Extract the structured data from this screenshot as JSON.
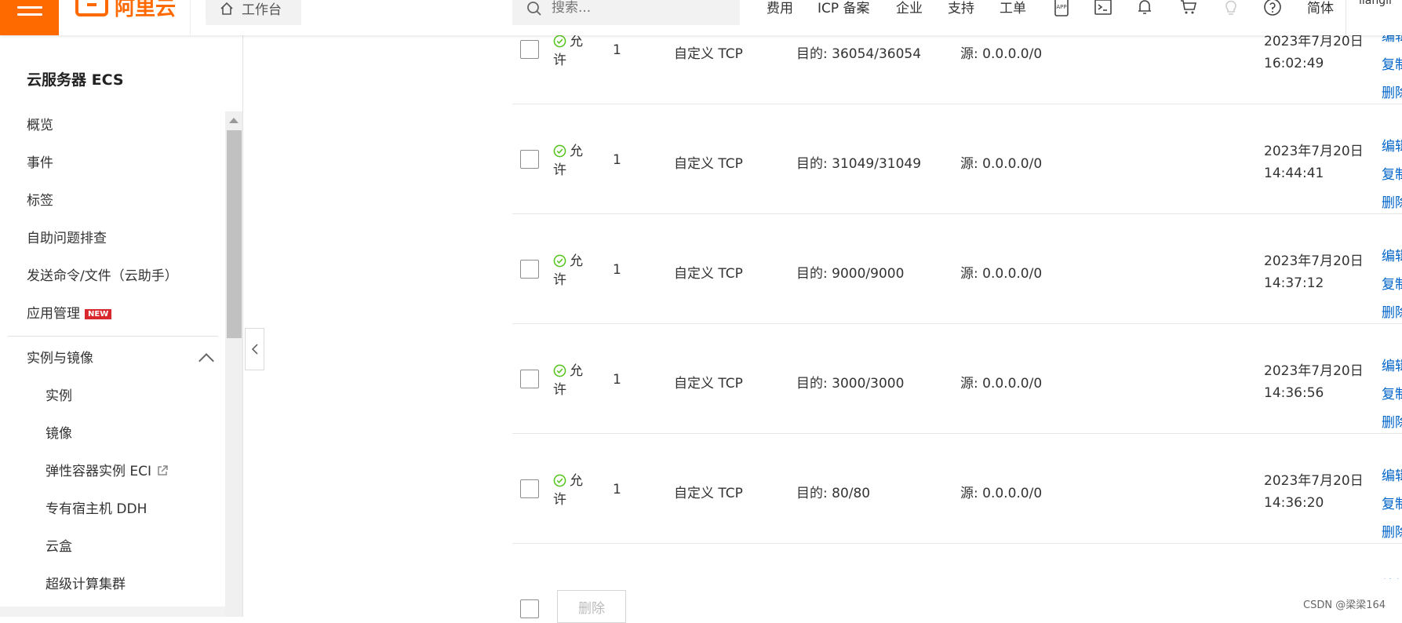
{
  "header": {
    "logo_text": "阿里云",
    "workbench_label": "工作台",
    "search_placeholder": "搜索...",
    "nav": [
      "费用",
      "ICP 备案",
      "企业",
      "支持",
      "工单"
    ],
    "icons": [
      "app-icon",
      "terminal-icon",
      "bell-icon",
      "cart-icon",
      "lightbulb-icon",
      "help-icon"
    ],
    "lang_label": "简体",
    "user_label": "liangli"
  },
  "sidebar": {
    "title": "云服务器 ECS",
    "items": [
      {
        "label": "概览"
      },
      {
        "label": "事件"
      },
      {
        "label": "标签"
      },
      {
        "label": "自助问题排查"
      },
      {
        "label": "发送命令/文件（云助手）"
      },
      {
        "label": "应用管理",
        "badge": "NEW"
      }
    ],
    "group": {
      "label": "实例与镜像",
      "children": [
        "实例",
        "镜像",
        "弹性容器实例 ECI",
        "专有宿主机 DDH",
        "云盒",
        "超级计算集群"
      ]
    }
  },
  "rules": {
    "rows": [
      {
        "action_1": "允",
        "action_2": "许",
        "priority": "1",
        "protocol": "自定义 TCP",
        "dest": "目的: 36054/36054",
        "source": "源: 0.0.0.0/0",
        "date": "2023年7月20日",
        "time": "16:02:49",
        "ops": [
          "编辑",
          "复制",
          "删除"
        ]
      },
      {
        "action_1": "允",
        "action_2": "许",
        "priority": "1",
        "protocol": "自定义 TCP",
        "dest": "目的: 31049/31049",
        "source": "源: 0.0.0.0/0",
        "date": "2023年7月20日",
        "time": "14:44:41",
        "ops": [
          "编辑",
          "复制",
          "删除"
        ]
      },
      {
        "action_1": "允",
        "action_2": "许",
        "priority": "1",
        "protocol": "自定义 TCP",
        "dest": "目的: 9000/9000",
        "source": "源: 0.0.0.0/0",
        "date": "2023年7月20日",
        "time": "14:37:12",
        "ops": [
          "编辑",
          "复制",
          "删除"
        ]
      },
      {
        "action_1": "允",
        "action_2": "许",
        "priority": "1",
        "protocol": "自定义 TCP",
        "dest": "目的: 3000/3000",
        "source": "源: 0.0.0.0/0",
        "date": "2023年7月20日",
        "time": "14:36:56",
        "ops": [
          "编辑",
          "复制",
          "删除"
        ]
      },
      {
        "action_1": "允",
        "action_2": "许",
        "priority": "1",
        "protocol": "自定义 TCP",
        "dest": "目的: 80/80",
        "source": "源: 0.0.0.0/0",
        "date": "2023年7月20日",
        "time": "14:36:20",
        "ops": [
          "编辑",
          "复制",
          "删除"
        ]
      }
    ],
    "bulk_delete_label": "删除"
  },
  "watermark": "CSDN @梁梁164",
  "colors": {
    "brand": "#ff6a00",
    "link": "#0064c8",
    "allow_green": "#52c41a",
    "new_badge": "#d9272e"
  }
}
